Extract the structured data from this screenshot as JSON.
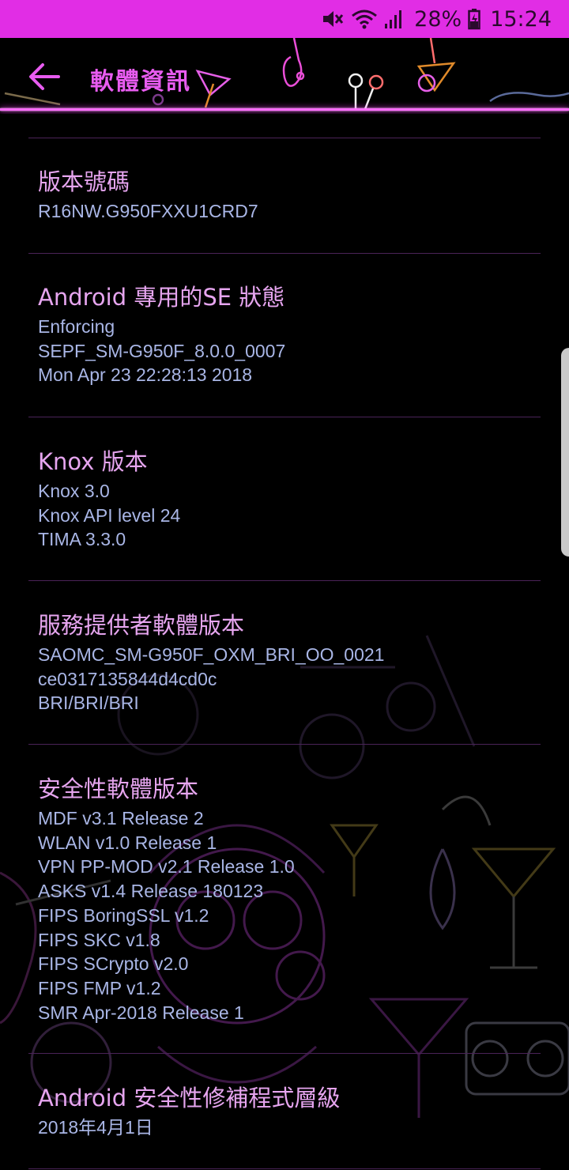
{
  "status_bar": {
    "battery": "28%",
    "time": "15:24",
    "color": "#e12de5",
    "icons": [
      "mute-icon",
      "wifi-icon",
      "signal-icon",
      "battery-icon"
    ]
  },
  "app_bar": {
    "title": "軟體資訊",
    "back_icon": "back-arrow-icon",
    "accent": "#e85cf0"
  },
  "items": [
    {
      "title": "版本號碼",
      "values": [
        "R16NW.G950FXXU1CRD7"
      ]
    },
    {
      "title": "Android 專用的SE 狀態",
      "values": [
        "Enforcing",
        "SEPF_SM-G950F_8.0.0_0007",
        "Mon Apr 23 22:28:13 2018"
      ]
    },
    {
      "title": "Knox 版本",
      "values": [
        "Knox 3.0",
        "Knox API level 24",
        "TIMA 3.3.0"
      ]
    },
    {
      "title": "服務提供者軟體版本",
      "values": [
        "SAOMC_SM-G950F_OXM_BRI_OO_0021",
        "ce0317135844d4cd0c",
        "BRI/BRI/BRI"
      ]
    },
    {
      "title": "安全性軟體版本",
      "values": [
        "MDF v3.1 Release 2",
        "WLAN v1.0 Release 1",
        "VPN PP-MOD v2.1 Release 1.0",
        "ASKS v1.4 Release 180123",
        "FIPS BoringSSL v1.2",
        "FIPS SKC v1.8",
        "FIPS SCrypto v2.0",
        "FIPS FMP v1.2",
        "SMR Apr-2018 Release 1"
      ]
    },
    {
      "title": "Android 安全性修補程式層級",
      "values": [
        "2018年4月1日"
      ]
    }
  ],
  "colors": {
    "title_text": "#e6a5ef",
    "value_text": "#a9b6e6",
    "divider": "#4a2358"
  }
}
